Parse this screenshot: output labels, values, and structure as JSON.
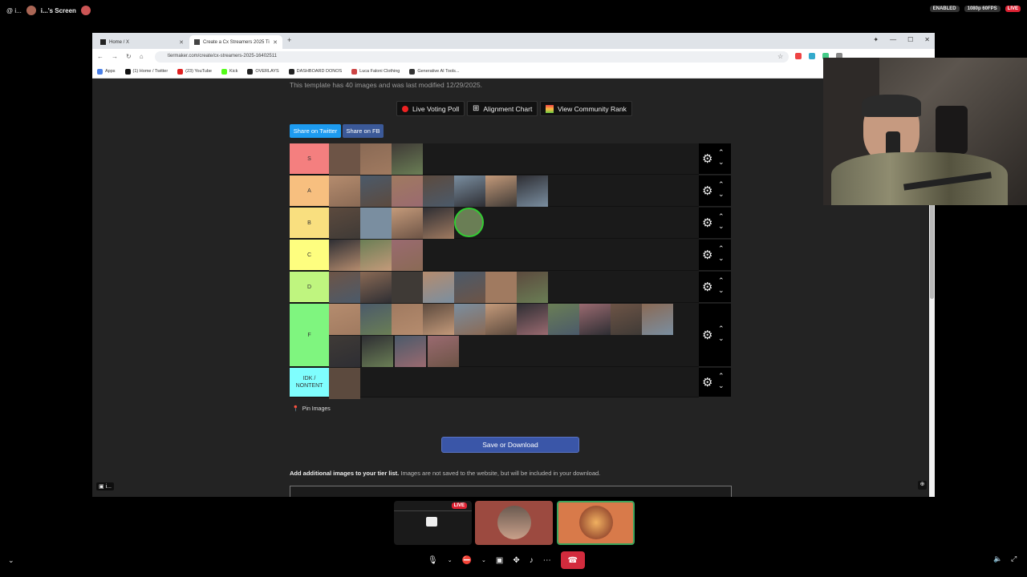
{
  "discord": {
    "left_label": "@ i...",
    "screen_label": "i...'s Screen",
    "enabled_badge": "ENABLED",
    "quality_badge": "1080p 60FPS",
    "live_badge": "LIVE",
    "user_tag": "i..."
  },
  "browser": {
    "tabs": [
      {
        "label": "Home / X"
      },
      {
        "label": "Create a Cx Streamers 2025 Ti"
      }
    ],
    "url": "tiermaker.com/create/cx-streamers-2025-16402511",
    "bookmarks": [
      {
        "label": "Apps",
        "color": "#4a80e8"
      },
      {
        "label": "(1) Home / Twitter",
        "color": "#111"
      },
      {
        "label": "(23) YouTube",
        "color": "#e02020"
      },
      {
        "label": "Kick",
        "color": "#53fc18"
      },
      {
        "label": "OVERLAYS",
        "color": "#222"
      },
      {
        "label": "DASHBOARD DONOS",
        "color": "#222"
      },
      {
        "label": "Luca Faloni Clothing",
        "color": "#c44"
      },
      {
        "label": "Generative AI Tools...",
        "color": "#333"
      }
    ]
  },
  "page": {
    "modified_text": "This template has 40 images and was last modified 12/29/2025.",
    "buttons": {
      "live_voting": "Live Voting Poll",
      "alignment": "Alignment Chart",
      "community": "View Community Rank"
    },
    "share_twitter": "Share on Twitter",
    "share_fb": "Share on FB",
    "tiers": [
      {
        "label": "S",
        "color": "#f47f7f"
      },
      {
        "label": "A",
        "color": "#f7bf7f"
      },
      {
        "label": "B",
        "color": "#f9df7f"
      },
      {
        "label": "C",
        "color": "#fefe7f"
      },
      {
        "label": "D",
        "color": "#bff57f"
      },
      {
        "label": "F",
        "color": "#7ff57f"
      },
      {
        "label": "IDK / NONTENT",
        "color": "#7ffefe"
      }
    ],
    "pin_images": "Pin Images",
    "save_button": "Save or Download",
    "add_images_bold": "Add additional images to your tier list.",
    "add_images_rest": " Images are not saved to the website, but will be included in your download."
  },
  "bottom": {
    "live_badge": "LIVE"
  }
}
